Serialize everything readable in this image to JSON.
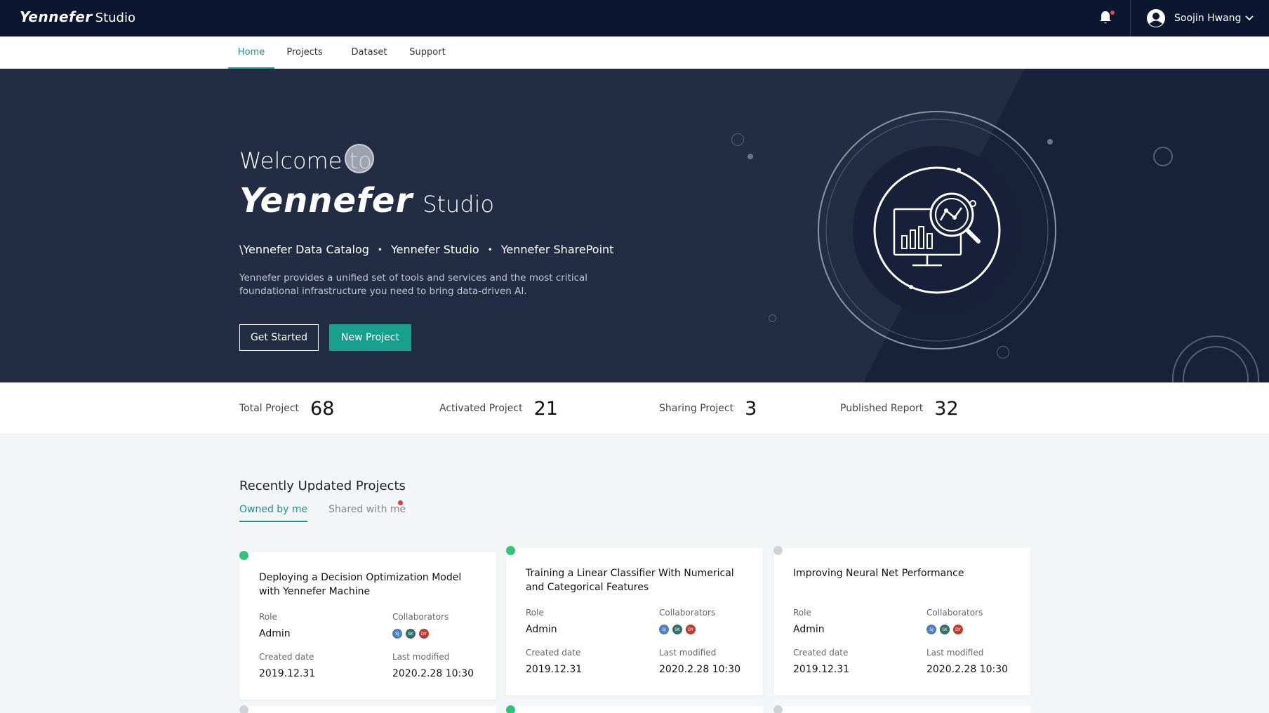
{
  "app": {
    "logo": "Yennefer",
    "studio": "Studio"
  },
  "header": {
    "user_name": "Soojin Hwang"
  },
  "nav": {
    "items": [
      "Home",
      "Projects",
      "Dataset",
      "Support"
    ],
    "active": "Home"
  },
  "hero": {
    "welcome": "Welcome to",
    "logo": "Yennefer",
    "studio": "Studio",
    "products": [
      "\\Yennefer Data Catalog",
      "Yennefer Studio",
      "Yennefer SharePoint"
    ],
    "description_line1": "Yennefer provides a unified set of tools and services and the most critical",
    "description_line2": "foundational infrastructure you need to bring data-driven AI.",
    "get_started": "Get Started",
    "new_project": "New Project"
  },
  "stats": [
    {
      "label": "Total Project",
      "value": "68"
    },
    {
      "label": "Activated Project",
      "value": "21"
    },
    {
      "label": "Sharing Project",
      "value": "3"
    },
    {
      "label": "Published Report",
      "value": "32"
    }
  ],
  "recent": {
    "title": "Recently Updated Projects",
    "tabs": [
      "Owned by me",
      "Shared with me"
    ],
    "role_label": "Role",
    "collaborators_label": "Collaborators",
    "created_label": "Created date",
    "modified_label": "Last modified",
    "cards": [
      {
        "title": "Deploying a Decision Optimization Model with Yennefer Machine",
        "status": "active",
        "role": "Admin",
        "created": "2019.12.31",
        "modified": "2020.2.28 10:30",
        "collaborators": [
          "SJ",
          "SK",
          "DY"
        ]
      },
      {
        "title": "Training a Linear Classifier With Numerical and Categorical Features",
        "status": "active",
        "role": "Admin",
        "created": "2019.12.31",
        "modified": "2020.2.28 10:30",
        "collaborators": [
          "SJ",
          "SK",
          "DY"
        ]
      },
      {
        "title": "Improving Neural Net Performance",
        "status": "inactive",
        "role": "Admin",
        "created": "2019.12.31",
        "modified": "2020.2.28 10:30",
        "collaborators": [
          "SJ",
          "SK",
          "DY"
        ]
      }
    ]
  },
  "colors": {
    "topbar": "#0b1730",
    "hero": "#222d44",
    "accent": "#18a08e",
    "status_active": "#2ec47a",
    "status_inactive": "#cfd2d7",
    "av_sj": "#4a7fc1",
    "av_sk": "#2e6f66",
    "av_dy": "#c0392b"
  },
  "icons": {
    "bell": "bell-icon",
    "user": "user-circle-icon",
    "chevron": "chevron-down-icon",
    "analytics": "monitor-analytics-icon"
  }
}
